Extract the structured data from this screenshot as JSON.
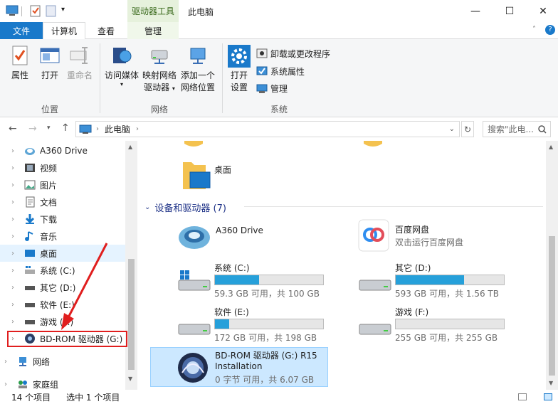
{
  "titlebar": {
    "context_tab": "驱动器工具",
    "title": "此电脑",
    "min": "—",
    "max": "☐",
    "close": "✕"
  },
  "tabs": {
    "file": "文件",
    "computer": "计算机",
    "view": "查看",
    "manage": "管理"
  },
  "ribbon": {
    "location": {
      "label": "位置",
      "properties": "属性",
      "open": "打开",
      "rename": "重命名"
    },
    "network": {
      "label": "网络",
      "access_media": "访问媒体",
      "map_drive_1": "映射网络",
      "map_drive_2": "驱动器",
      "add_location_1": "添加一个",
      "add_location_2": "网络位置"
    },
    "system": {
      "label": "系统",
      "open_settings_1": "打开",
      "open_settings_2": "设置",
      "uninstall": "卸载或更改程序",
      "sys_props": "系统属性",
      "manage": "管理"
    }
  },
  "address": {
    "path": "此电脑",
    "search_placeholder": "搜索\"此电..."
  },
  "nav": [
    {
      "label": "A360 Drive"
    },
    {
      "label": "视频"
    },
    {
      "label": "图片"
    },
    {
      "label": "文档"
    },
    {
      "label": "下载"
    },
    {
      "label": "音乐"
    },
    {
      "label": "桌面"
    },
    {
      "label": "系统 (C:)"
    },
    {
      "label": "其它 (D:)"
    },
    {
      "label": "软件 (E:)"
    },
    {
      "label": "游戏 (F:)"
    },
    {
      "label": "BD-ROM 驱动器 (G:)"
    },
    {
      "label": "网络"
    },
    {
      "label": "家庭组"
    }
  ],
  "content": {
    "desktop_label": "桌面",
    "section_title": "设备和驱动器 (7)",
    "a360": "A360 Drive",
    "baidu_name": "百度网盘",
    "baidu_sub": "双击运行百度网盘",
    "drives": [
      {
        "name": "系统 (C:)",
        "info": "59.3 GB 可用，共 100 GB",
        "used_fraction": 0.41
      },
      {
        "name": "其它 (D:)",
        "info": "593 GB 可用，共 1.56 TB",
        "used_fraction": 0.63
      },
      {
        "name": "软件 (E:)",
        "info": "172 GB 可用，共 198 GB",
        "used_fraction": 0.13
      },
      {
        "name": "游戏 (F:)",
        "info": "255 GB 可用，共 255 GB",
        "used_fraction": 0.0
      }
    ],
    "bdrom_line1": "BD-ROM 驱动器 (G:) R15",
    "bdrom_line2": "Installation",
    "bdrom_info": "0 字节 可用，共 6.07 GB"
  },
  "status": {
    "count": "14 个项目",
    "selected": "选中 1 个项目"
  },
  "colors": {
    "accent": "#1979ca",
    "bar_fill": "#26a0da",
    "highlight": "#e01e1e",
    "selected_bg": "#cce8ff"
  }
}
